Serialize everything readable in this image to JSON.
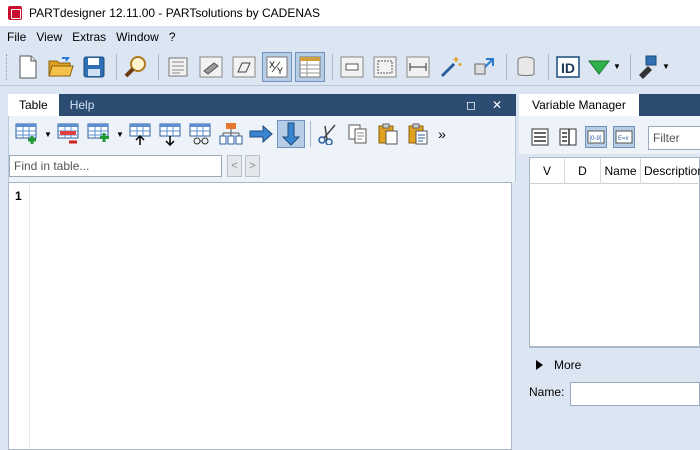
{
  "window": {
    "title": "PARTdesigner 12.11.00 - PARTsolutions by CADENAS"
  },
  "menu": [
    "File",
    "View",
    "Extras",
    "Window",
    "?"
  ],
  "main_toolbar": {
    "icons": [
      "new-document-icon",
      "open-folder-icon",
      "save-icon",
      "search-magnifier-icon",
      "properties-icon",
      "model-icon",
      "sketch-icon",
      "variable-xy-icon",
      "table-icon",
      "component-icon",
      "frame-icon",
      "dimension-icon",
      "magic-wand-icon",
      "transfer-icon",
      "database-icon",
      "id-icon",
      "filter-triangle-icon",
      "export-icon"
    ]
  },
  "left_panel": {
    "tabs": [
      {
        "label": "Table",
        "active": true
      },
      {
        "label": "Help",
        "active": false
      }
    ],
    "maximize_glyph": "◻",
    "close_glyph": "✕",
    "overflow_glyph": "»",
    "find_placeholder": "Find in table...",
    "prev_glyph": "<",
    "next_glyph": ">",
    "line_numbers": [
      "1"
    ]
  },
  "right_panel": {
    "tab_label": "Variable Manager",
    "filter_placeholder": "Filter",
    "columns": [
      "V",
      "D",
      "Name",
      "Description"
    ],
    "more_label": "More",
    "name_label": "Name:"
  },
  "colors": {
    "menu_bg": "#dce6f2",
    "panel_header": "#2d4c72",
    "accent_red": "#c8102e"
  }
}
